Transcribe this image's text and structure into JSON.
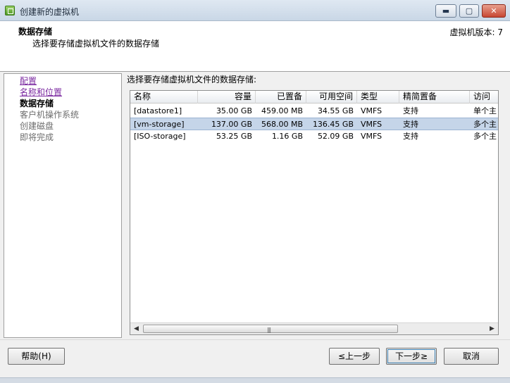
{
  "window": {
    "title": "创建新的虚拟机",
    "minimize": "▬",
    "maximize": "▢",
    "close": "✕"
  },
  "header": {
    "title": "数据存储",
    "subtitle": "选择要存储虚拟机文件的数据存储",
    "version": "虚拟机版本: 7"
  },
  "nav": {
    "items": [
      {
        "label": "配置",
        "state": "link"
      },
      {
        "label": "名称和位置",
        "state": "link"
      },
      {
        "label": "数据存储",
        "state": "current"
      },
      {
        "label": "客户机操作系统",
        "state": "disabled"
      },
      {
        "label": "创建磁盘",
        "state": "disabled"
      },
      {
        "label": "即将完成",
        "state": "disabled"
      }
    ]
  },
  "content": {
    "label": "选择要存储虚拟机文件的数据存储:"
  },
  "table": {
    "columns": [
      "名称",
      "容量",
      "已置备",
      "可用空间",
      "类型",
      "精简置备",
      "访问"
    ],
    "rows": [
      [
        "[datastore1]",
        "35.00 GB",
        "459.00 MB",
        "34.55 GB",
        "VMFS",
        "支持",
        "单个主"
      ],
      [
        "[vm-storage]",
        "137.00 GB",
        "568.00 MB",
        "136.45 GB",
        "VMFS",
        "支持",
        "多个主"
      ],
      [
        "[ISO-storage]",
        "53.25 GB",
        "1.16 GB",
        "52.09 GB",
        "VMFS",
        "支持",
        "多个主"
      ]
    ],
    "selected_row": 1,
    "scroll_left": "◀",
    "scroll_right": "▶",
    "scroll_grip": "|||"
  },
  "footer": {
    "help": "帮助(H)",
    "back": "≤上一步",
    "next": "下一步≥",
    "cancel": "取消"
  }
}
